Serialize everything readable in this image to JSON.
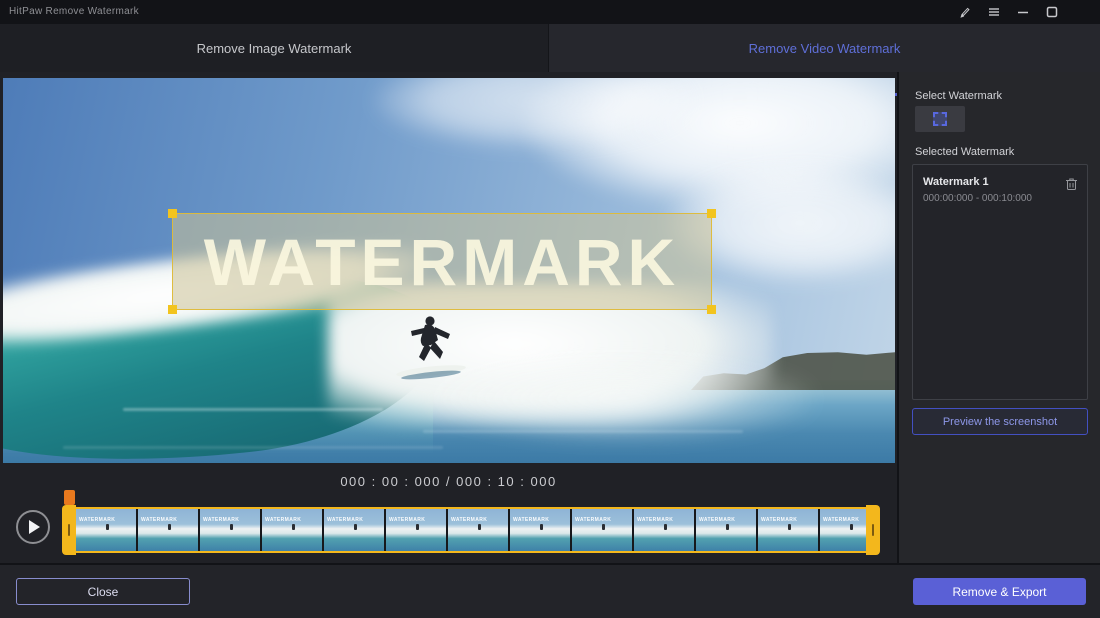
{
  "app": {
    "title": "HitPaw Remove Watermark"
  },
  "tabs": [
    {
      "label": "Remove Image Watermark",
      "active": false
    },
    {
      "label": "Remove Video Watermark",
      "active": true
    }
  ],
  "preview": {
    "watermark_text": "WATERMARK",
    "timecode": "000 : 00 : 000 / 000 : 10 : 000"
  },
  "timeline": {
    "thumbnail_count": 13,
    "thumb_watermark_text": "WATERMARK"
  },
  "right_panel": {
    "select_watermark_label": "Select Watermark",
    "selected_watermark_label": "Selected Watermark",
    "watermark_items": [
      {
        "name": "Watermark 1",
        "range": "000:00:000 - 000:10:000"
      }
    ],
    "preview_button_label": "Preview the screenshot"
  },
  "footer": {
    "close_label": "Close",
    "export_label": "Remove & Export"
  },
  "colors": {
    "accent_purple": "#5a60d6",
    "tab_active_text": "#5f6fd8",
    "timeline_handle_yellow": "#f3b71c",
    "playhead_orange": "#e8791e",
    "watermark_handle_yellow": "#f2c41f"
  }
}
